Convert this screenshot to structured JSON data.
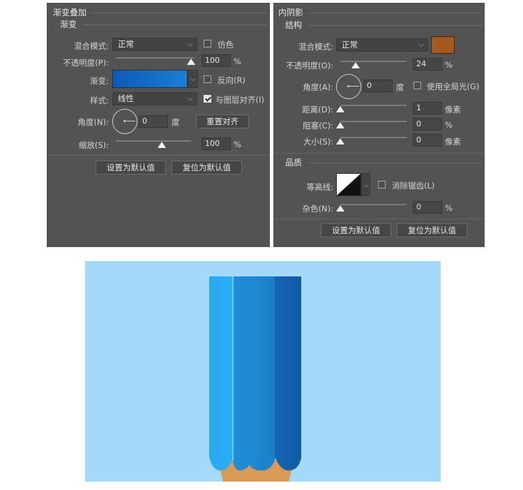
{
  "left_panel": {
    "title": "渐变叠加",
    "section": "渐变",
    "blend_mode_label": "混合模式:",
    "blend_mode_value": "正常",
    "dither_label": "仿色",
    "opacity_label": "不透明度(P):",
    "opacity_value": "100",
    "opacity_unit": "%",
    "gradient_label": "渐变:",
    "gradient_colors": [
      "#0d5ab8",
      "#1a7fd4"
    ],
    "reverse_label": "反向(R)",
    "style_label": "样式:",
    "style_value": "线性",
    "align_label": "与图层对齐(I)",
    "angle_label": "角度(N):",
    "angle_value": "0",
    "angle_unit": "度",
    "reset_align_button": "重置对齐",
    "scale_label": "缩放(S):",
    "scale_value": "100",
    "scale_unit": "%",
    "set_default_button": "设置为默认值",
    "reset_default_button": "复位为默认值"
  },
  "right_panel": {
    "title": "内阴影",
    "structure_section": "结构",
    "blend_mode_label": "混合模式:",
    "blend_mode_value": "正常",
    "shadow_color": "#a5591a",
    "opacity_label": "不透明度(O):",
    "opacity_value": "24",
    "opacity_unit": "%",
    "angle_label": "角度(A):",
    "angle_value": "0",
    "angle_unit": "度",
    "global_light_label": "使用全局光(G)",
    "distance_label": "距离(D):",
    "distance_value": "1",
    "distance_unit": "像素",
    "choke_label": "阻塞(C):",
    "choke_value": "0",
    "choke_unit": "%",
    "size_label": "大小(S):",
    "size_value": "0",
    "size_unit": "像素",
    "quality_section": "品质",
    "contour_label": "等高线:",
    "antialias_label": "消除锯齿(L)",
    "noise_label": "杂色(N):",
    "noise_value": "0",
    "noise_unit": "%",
    "set_default_button": "设置为默认值",
    "reset_default_button": "复位为默认值"
  },
  "preview": {
    "background_color": "#a3dafb",
    "pencil_colors": [
      "#29a9f0",
      "#1f8fd8",
      "#1466b3"
    ],
    "wood_color": "#d99a56"
  }
}
